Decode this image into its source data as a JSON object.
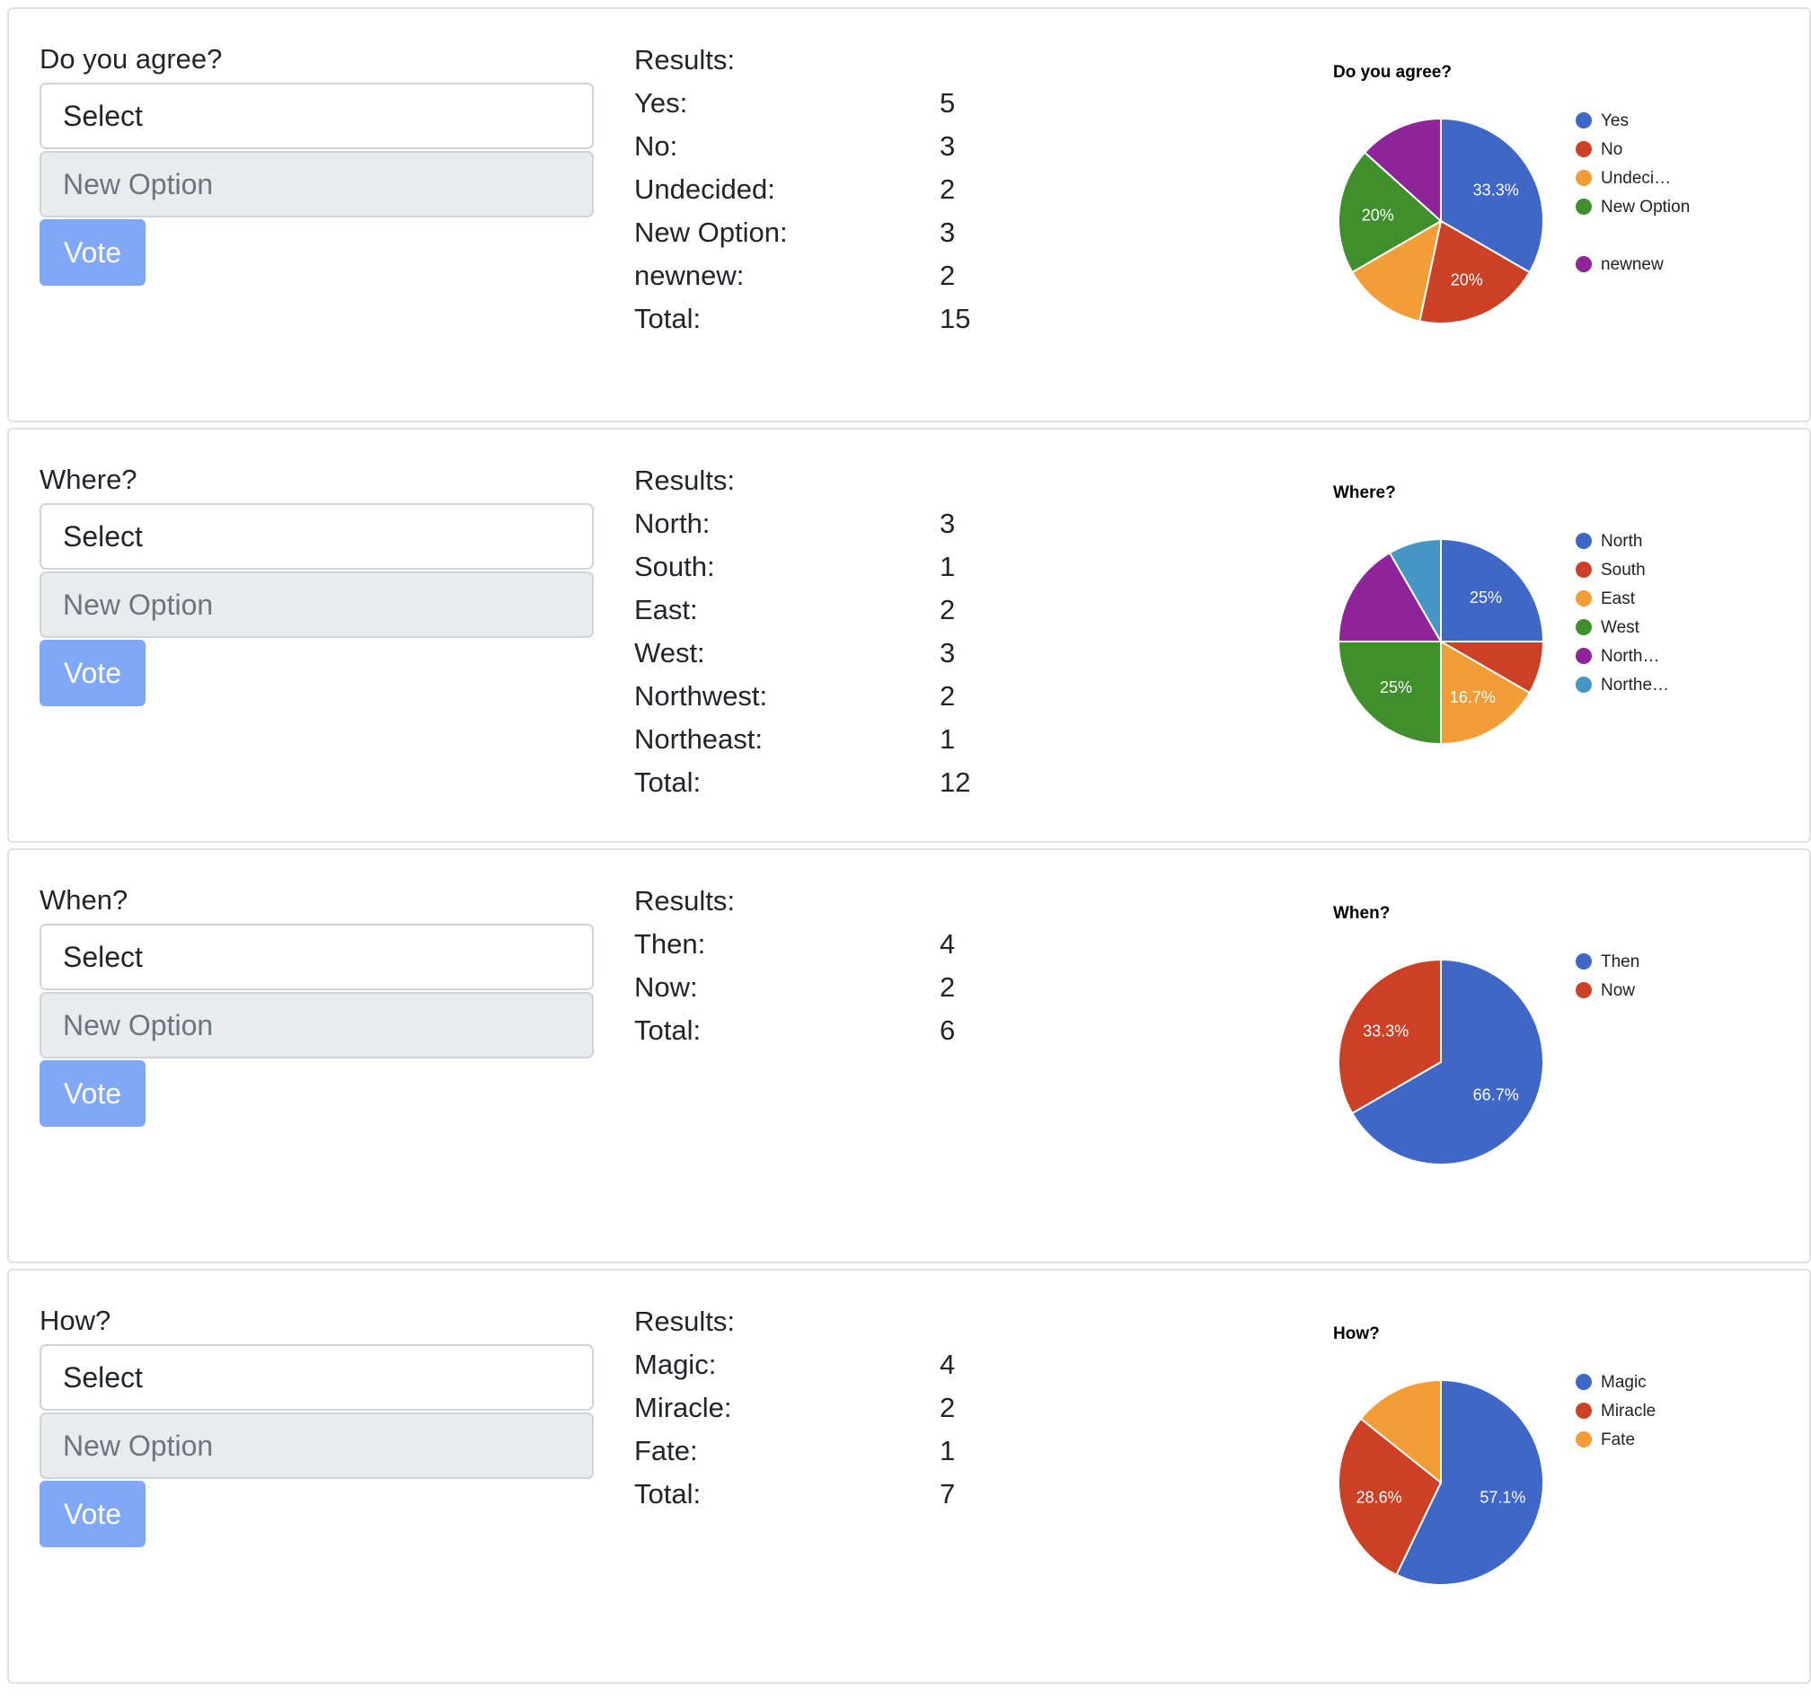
{
  "polls": [
    {
      "question": "Do you agree?",
      "select_label": "Select",
      "new_option_placeholder": "New Option",
      "vote_label": "Vote",
      "results_label": "Results:",
      "results": [
        {
          "label": "Yes:",
          "value": "5"
        },
        {
          "label": "No:",
          "value": "3"
        },
        {
          "label": "Undecided:",
          "value": "2"
        },
        {
          "label": "New Option:",
          "value": "3"
        },
        {
          "label": "newnew:",
          "value": "2"
        },
        {
          "label": "Total:",
          "value": "15"
        }
      ],
      "chart_data": {
        "type": "pie",
        "title": "Do you agree?",
        "categories": [
          "Yes",
          "No",
          "Undeci…",
          "New Option",
          "newnew"
        ],
        "values": [
          5,
          3,
          2,
          3,
          2
        ],
        "slice_labels": [
          "33.3%",
          "20%",
          "",
          "20%",
          ""
        ],
        "colors": [
          "#3e67c8",
          "#cc4125",
          "#f29d38",
          "#3f8f2c",
          "#8d249a"
        ],
        "legend_position": "right"
      }
    },
    {
      "question": "Where?",
      "select_label": "Select",
      "new_option_placeholder": "New Option",
      "vote_label": "Vote",
      "results_label": "Results:",
      "results": [
        {
          "label": "North:",
          "value": "3"
        },
        {
          "label": "South:",
          "value": "1"
        },
        {
          "label": "East:",
          "value": "2"
        },
        {
          "label": "West:",
          "value": "3"
        },
        {
          "label": "Northwest:",
          "value": "2"
        },
        {
          "label": "Northeast:",
          "value": "1"
        },
        {
          "label": "Total:",
          "value": "12"
        }
      ],
      "chart_data": {
        "type": "pie",
        "title": "Where?",
        "categories": [
          "North",
          "South",
          "East",
          "West",
          "North…",
          "Northe…"
        ],
        "values": [
          3,
          1,
          2,
          3,
          2,
          1
        ],
        "slice_labels": [
          "25%",
          "",
          "16.7%",
          "25%",
          "",
          ""
        ],
        "colors": [
          "#3e67c8",
          "#cc4125",
          "#f29d38",
          "#3f8f2c",
          "#8d249a",
          "#4696c4"
        ],
        "legend_position": "right"
      }
    },
    {
      "question": "When?",
      "select_label": "Select",
      "new_option_placeholder": "New Option",
      "vote_label": "Vote",
      "results_label": "Results:",
      "results": [
        {
          "label": "Then:",
          "value": "4"
        },
        {
          "label": "Now:",
          "value": "2"
        },
        {
          "label": "Total:",
          "value": "6"
        }
      ],
      "chart_data": {
        "type": "pie",
        "title": "When?",
        "categories": [
          "Then",
          "Now"
        ],
        "values": [
          4,
          2
        ],
        "slice_labels": [
          "66.7%",
          "33.3%"
        ],
        "colors": [
          "#3e67c8",
          "#cc4125"
        ],
        "legend_position": "right"
      }
    },
    {
      "question": "How?",
      "select_label": "Select",
      "new_option_placeholder": "New Option",
      "vote_label": "Vote",
      "results_label": "Results:",
      "results": [
        {
          "label": "Magic:",
          "value": "4"
        },
        {
          "label": "Miracle:",
          "value": "2"
        },
        {
          "label": "Fate:",
          "value": "1"
        },
        {
          "label": "Total:",
          "value": "7"
        }
      ],
      "chart_data": {
        "type": "pie",
        "title": "How?",
        "categories": [
          "Magic",
          "Miracle",
          "Fate"
        ],
        "values": [
          4,
          2,
          1
        ],
        "slice_labels": [
          "57.1%",
          "28.6%",
          ""
        ],
        "colors": [
          "#3e67c8",
          "#cc4125",
          "#f29d38"
        ],
        "legend_position": "right"
      }
    }
  ]
}
